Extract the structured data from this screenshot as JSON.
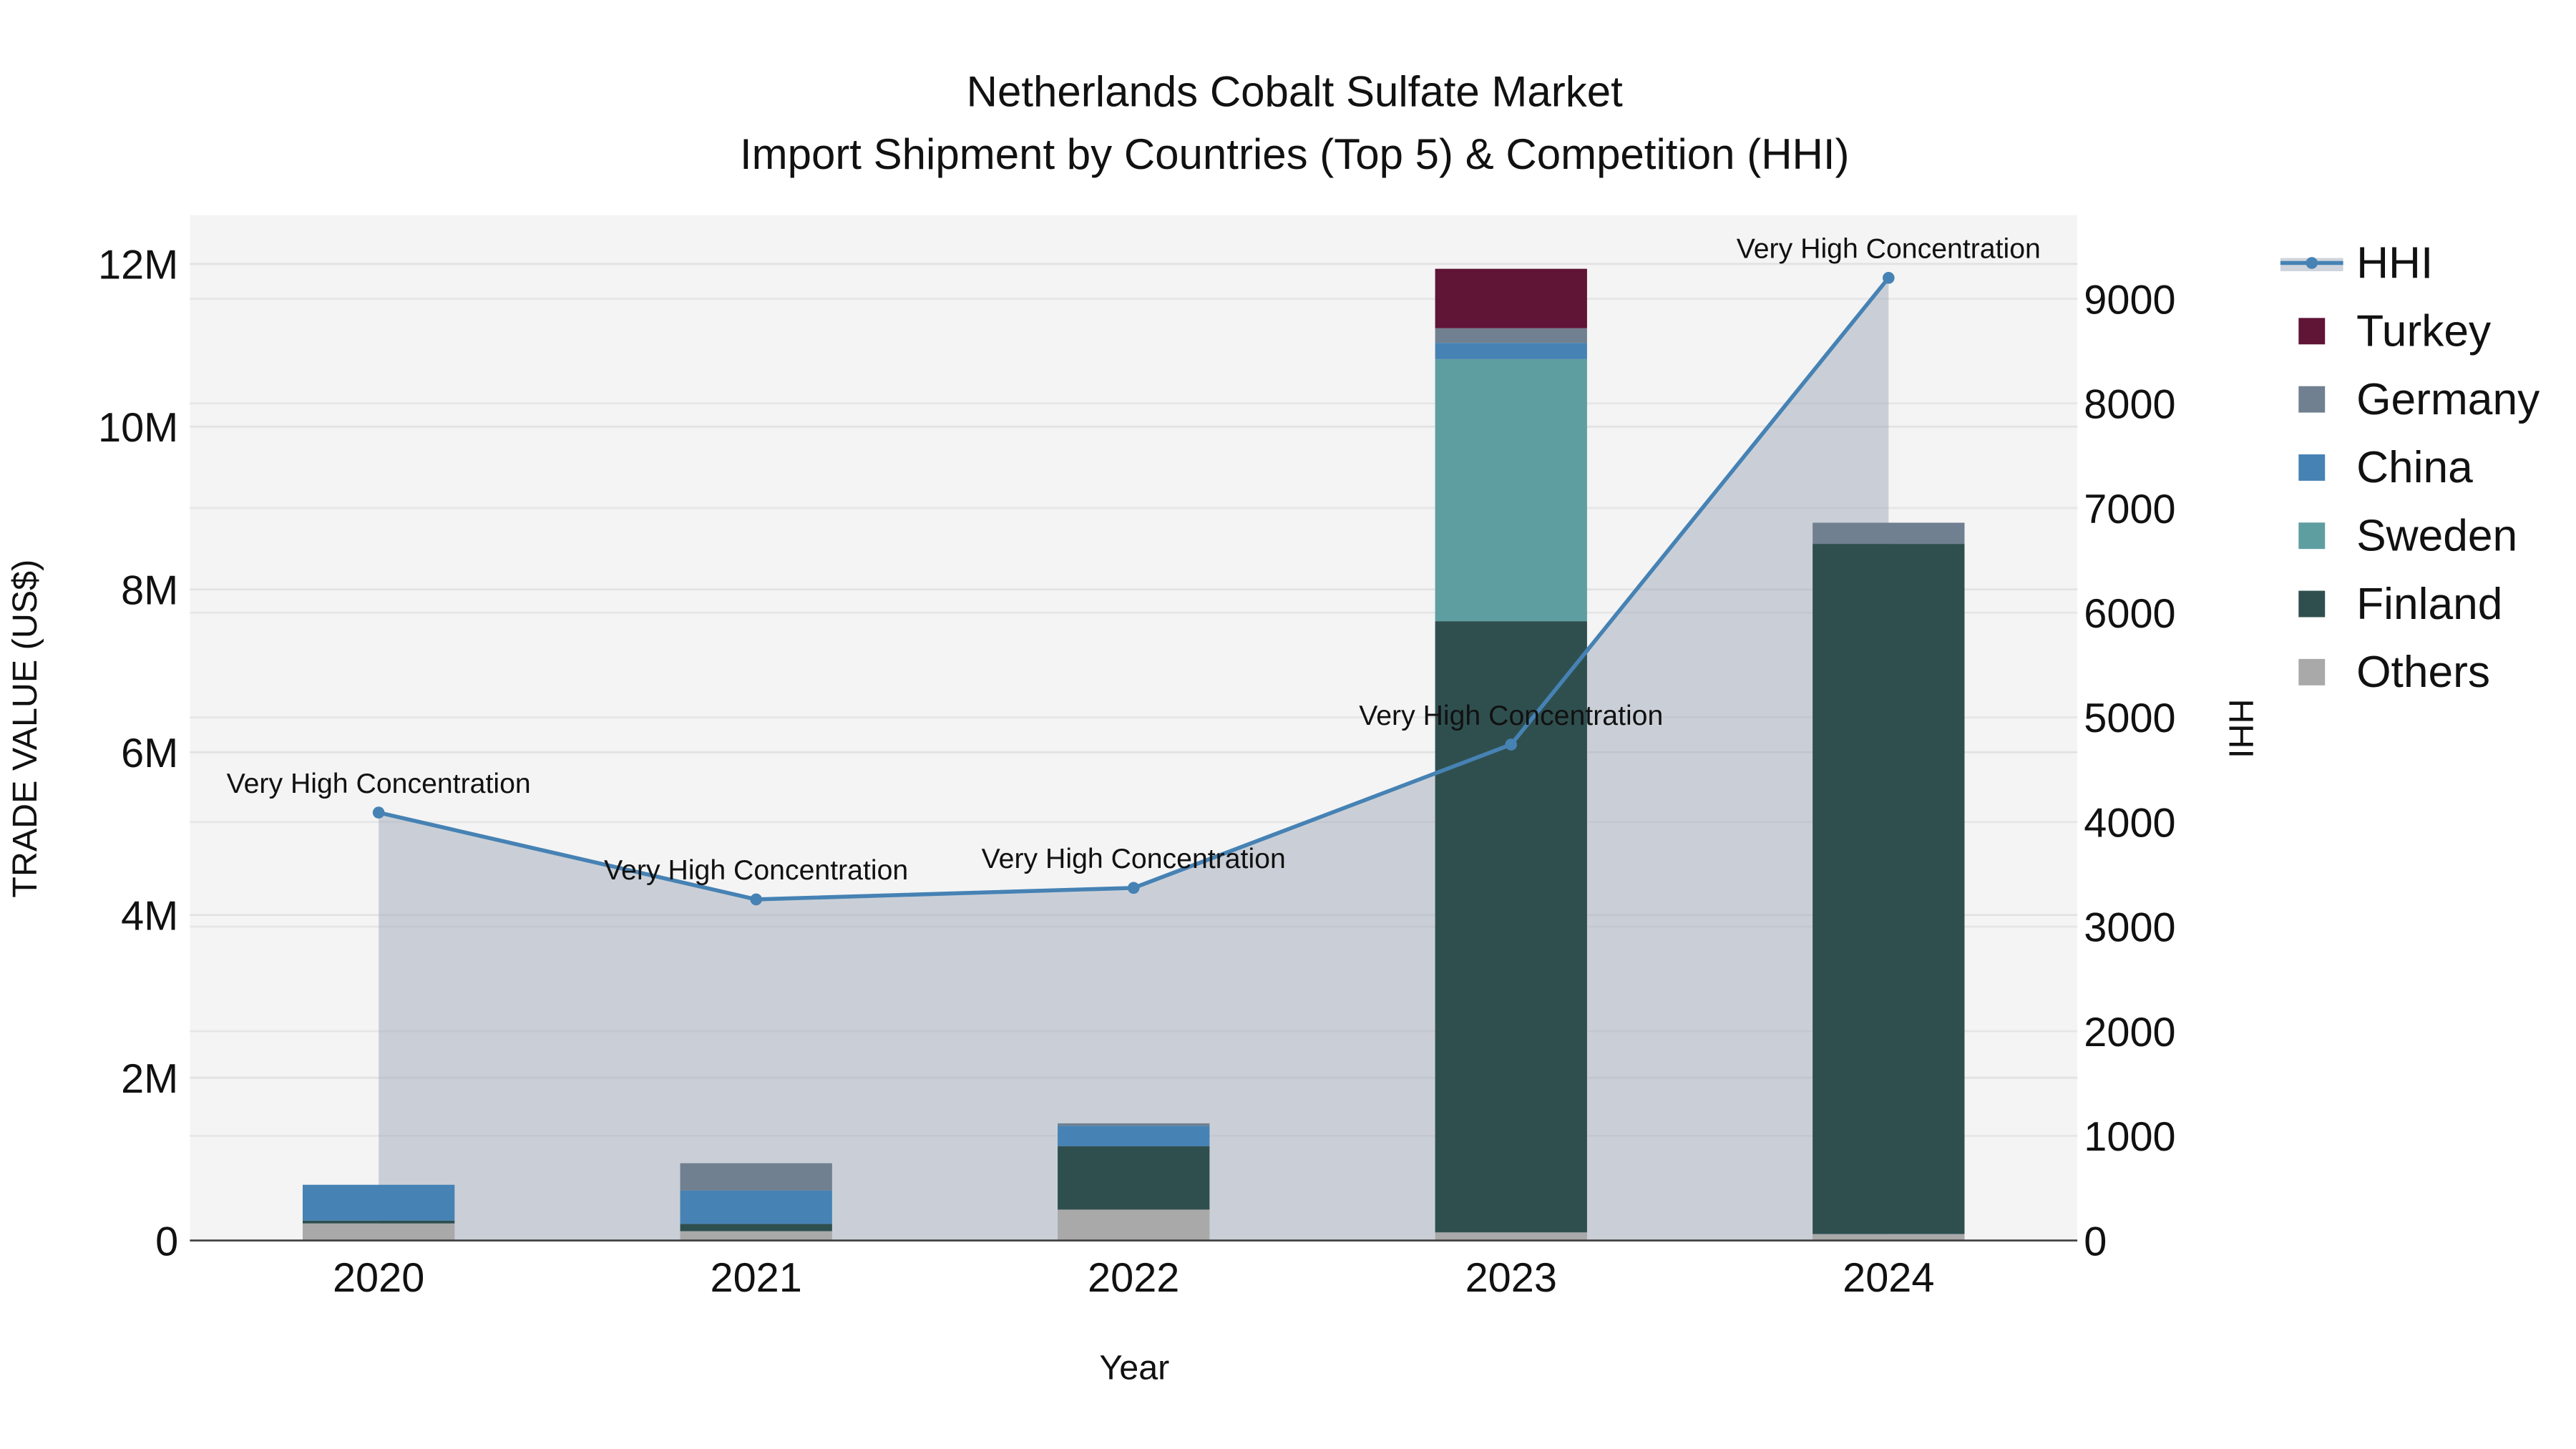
{
  "chart_data": {
    "type": "bar",
    "title": "Netherlands Cobalt Sulfate Market",
    "subtitle": "Import Shipment by Countries (Top 5) & Competition (HHI)",
    "xlabel": "Year",
    "ylabel": "TRADE VALUE (US$)",
    "y2label": "HHI",
    "categories": [
      "2020",
      "2021",
      "2022",
      "2023",
      "2024"
    ],
    "ylim": [
      0,
      12600000
    ],
    "y2lim": [
      0,
      9800
    ],
    "yticks": [
      0,
      2000000,
      4000000,
      6000000,
      8000000,
      10000000,
      12000000
    ],
    "ytick_labels": [
      "0",
      "2M",
      "4M",
      "6M",
      "8M",
      "10M",
      "12M"
    ],
    "y2ticks": [
      0,
      1000,
      2000,
      3000,
      4000,
      5000,
      6000,
      7000,
      8000,
      9000
    ],
    "y2tick_labels": [
      "0",
      "1000",
      "2000",
      "3000",
      "4000",
      "5000",
      "6000",
      "7000",
      "8000",
      "9000"
    ],
    "stacked": true,
    "series": [
      {
        "name": "Others",
        "color": "#a9a9a9",
        "values": [
          210000,
          115000,
          380000,
          100000,
          80000
        ]
      },
      {
        "name": "Finland",
        "color": "#2f4f4f",
        "values": [
          35000,
          90000,
          780000,
          7510000,
          8480000
        ]
      },
      {
        "name": "Sweden",
        "color": "#5f9ea0",
        "values": [
          0,
          0,
          0,
          3220000,
          0
        ]
      },
      {
        "name": "China",
        "color": "#4682b4",
        "values": [
          440000,
          410000,
          250000,
          200000,
          0
        ]
      },
      {
        "name": "Germany",
        "color": "#708090",
        "values": [
          0,
          335000,
          30000,
          180000,
          260000
        ]
      },
      {
        "name": "Turkey",
        "color": "#601436",
        "values": [
          0,
          0,
          0,
          730000,
          0
        ]
      }
    ],
    "hhi": {
      "name": "HHI",
      "color": "#4682b4",
      "values": [
        4090,
        3260,
        3370,
        4740,
        9200
      ],
      "annotations": [
        "Very High Concentration",
        "Very High Concentration",
        "Very High Concentration",
        "Very High Concentration",
        "Very High Concentration"
      ]
    },
    "legend_order": [
      "HHI",
      "Turkey",
      "Germany",
      "China",
      "Sweden",
      "Finland",
      "Others"
    ],
    "legend_placement": "right",
    "grid": true
  }
}
